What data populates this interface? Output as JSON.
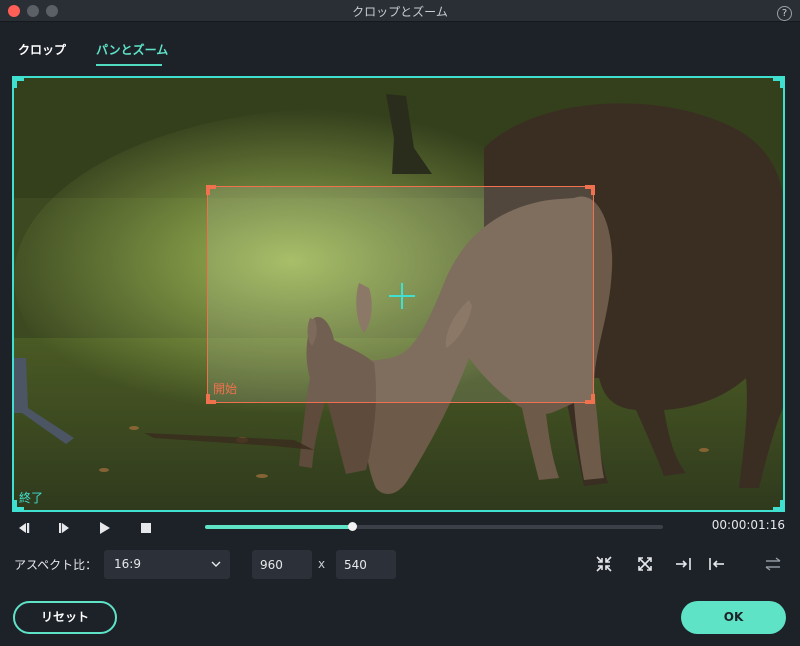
{
  "window": {
    "title": "クロップとズーム",
    "help_glyph": "?"
  },
  "tabs": [
    {
      "label": "クロップ",
      "active": false
    },
    {
      "label": "パンとズーム",
      "active": true
    }
  ],
  "viewer": {
    "start_label": "開始",
    "end_label": "終了",
    "image_subject": "deer grazing on grass"
  },
  "transport": {
    "buttons": [
      "step-back-icon",
      "step-forward-icon",
      "play-icon",
      "stop-icon"
    ],
    "progress": 0.32,
    "timecode": "00:00:01:16"
  },
  "aspect": {
    "label": "アスペクト比：",
    "selected": "16:9",
    "width": "960",
    "height": "540",
    "separator": "x"
  },
  "tools": [
    "shrink-to-center-icon",
    "expand-to-corners-icon",
    "align-right-icon",
    "align-left-icon",
    "swap-icon"
  ],
  "footer": {
    "reset_label": "リセット",
    "ok_label": "OK"
  },
  "colors": {
    "accent": "#5ee3c7",
    "frame_border": "#3fe0d0",
    "start_box": "#f0714e",
    "background": "#1d2128"
  }
}
